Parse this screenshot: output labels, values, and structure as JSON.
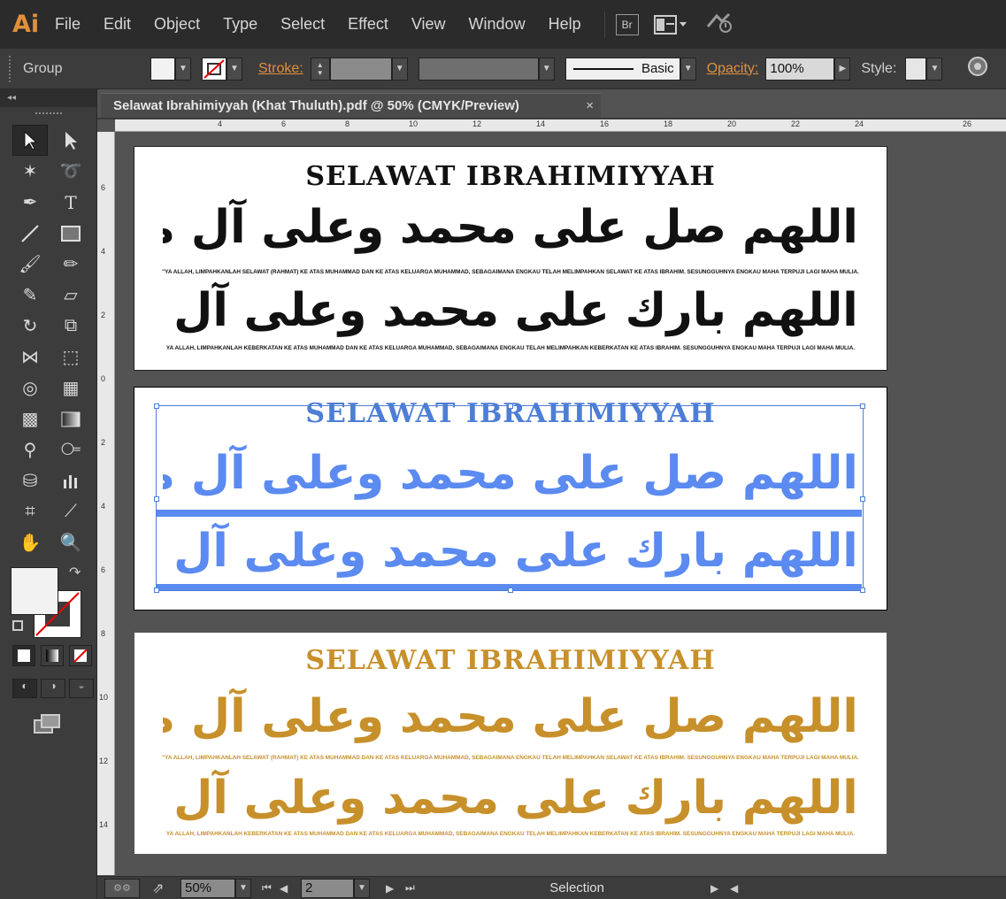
{
  "app": {
    "logo": "Ai"
  },
  "menu": [
    "File",
    "Edit",
    "Object",
    "Type",
    "Select",
    "Effect",
    "View",
    "Window",
    "Help"
  ],
  "menu_icons": {
    "bridge": "Br"
  },
  "control": {
    "selection_type": "Group",
    "stroke_label": "Stroke:",
    "brush_label": "Basic",
    "opacity_label": "Opacity:",
    "opacity_value": "100%",
    "style_label": "Style:"
  },
  "document": {
    "tab_title": "Selawat Ibrahimiyyah (Khat Thuluth).pdf @ 50% (CMYK/Preview)",
    "close_glyph": "×"
  },
  "ruler_h": [
    "4",
    "6",
    "8",
    "10",
    "12",
    "14",
    "16",
    "18",
    "20",
    "22",
    "24",
    "26"
  ],
  "ruler_v": [
    "6",
    "4",
    "2",
    "0",
    "2",
    "4",
    "6",
    "8",
    "10",
    "12",
    "14"
  ],
  "artboards": {
    "title": "SELAWAT IBRAHIMIYYAH",
    "arabic_line1": "اللهم صل على محمد وعلى آل محمد كما صليت على إبراهيم إنك حميد مجيد",
    "trans_line1": "\"YA ALLAH, LIMPAHKANLAH SELAWAT (RAHMAT) KE ATAS MUHAMMAD DAN KE ATAS KELUARGA MUHAMMAD, SEBAGAIMANA ENGKAU TELAH MELIMPAHKAN SELAWAT KE ATAS IBRAHIM. SESUNGGUHNYA ENGKAU MAHA TERPUJI LAGI MAHA MULIA.",
    "arabic_line2": "اللهم بارك على محمد وعلى آل محمد كما باركت على آل إبراهيم إنك حميد مجيد",
    "trans_line2": "YA ALLAH, LIMPAHKANLAH KEBERKATAN KE ATAS MUHAMMAD DAN KE ATAS KELUARGA MUHAMMAD, SEBAGAIMANA ENGKAU TELAH MELIMPAHKAN KEBERKATAN KE ATAS IBRAHIM. SESUNGGUHNYA ENGKAU MAHA TERPUJI LAGI MAHA MULIA."
  },
  "colors": {
    "accent": "#e0903a",
    "selection": "#4d7ed6",
    "gold": "#c7902b"
  },
  "status": {
    "zoom": "50%",
    "artboard_number": "2",
    "tool_name": "Selection"
  }
}
